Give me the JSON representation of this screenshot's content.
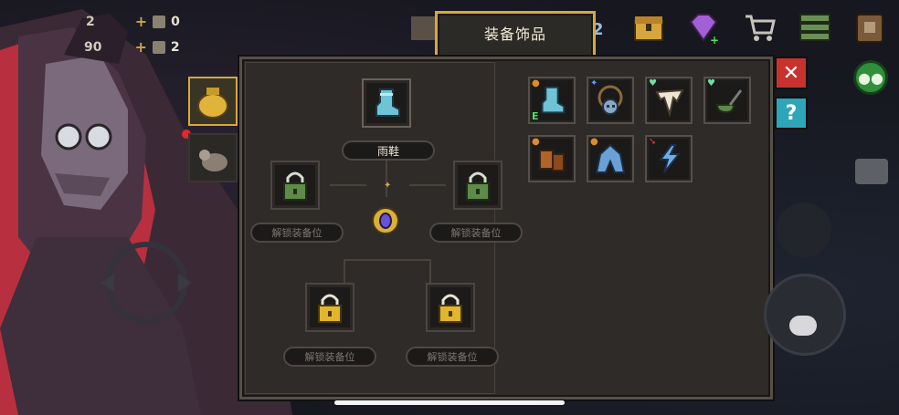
{
  "header": {
    "title": "装备饰品"
  },
  "resources": [
    {
      "prefix_value": "2",
      "value": "0",
      "icon": "bag-icon"
    },
    {
      "prefix_value": "90",
      "value": "2",
      "icon": "bag-icon"
    }
  ],
  "top_bar_icons": [
    "gem-plus-icon",
    "treasure-chest-icon",
    "diamond-plus-icon",
    "shopping-cart-icon",
    "menu-list-icon",
    "backpack-icon"
  ],
  "top_bar_partial_value": "2",
  "equip_slots": {
    "boots": {
      "label": "雨鞋",
      "icon": "rain-boots-icon"
    },
    "center_icon": "amulet-icon",
    "locked": [
      {
        "label": "解锁装备位",
        "lock_color": "green"
      },
      {
        "label": "解锁装备位",
        "lock_color": "green"
      },
      {
        "label": "解锁装备位",
        "lock_color": "gold"
      },
      {
        "label": "解锁装备位",
        "lock_color": "gold"
      }
    ]
  },
  "inventory": [
    {
      "icon": "rain-boots-icon",
      "badge": "orange-pin",
      "equipped_mark": "E"
    },
    {
      "icon": "skull-necklace-icon",
      "badge": "blue-star",
      "equipped_mark": ""
    },
    {
      "icon": "fang-horn-icon",
      "badge": "green-heart",
      "equipped_mark": ""
    },
    {
      "icon": "green-pipe-icon",
      "badge": "green-heart",
      "equipped_mark": ""
    },
    {
      "icon": "leather-bag-icon",
      "badge": "orange-pin",
      "equipped_mark": ""
    },
    {
      "icon": "hooded-cloak-icon",
      "badge": "orange-pin",
      "equipped_mark": ""
    },
    {
      "icon": "lightning-icon",
      "badge": "red-arrow",
      "equipped_mark": ""
    }
  ],
  "buttons": {
    "close": "✕",
    "help": "?"
  },
  "colors": {
    "accent_gold": "#d6aa3a",
    "close_red": "#c8322e",
    "help_teal": "#2ea6b9",
    "chat_green": "#2f8f3a",
    "notify_red": "#e02a2a"
  }
}
